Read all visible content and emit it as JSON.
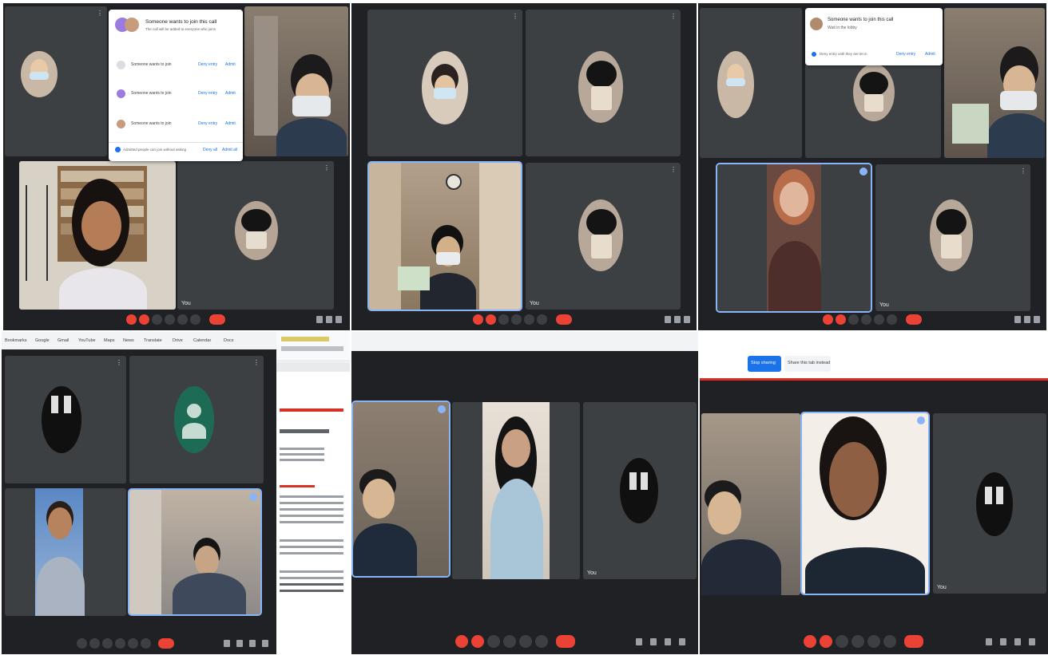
{
  "panels": {
    "top_left": {
      "popup": {
        "title": "Someone wants to join this call",
        "subtitle": "The call will be added to everyone who joins",
        "rows": [
          {
            "name": "Someone wants to join",
            "deny": "Deny entry",
            "admit": "Admit"
          },
          {
            "name": "Someone wants to join",
            "deny": "Deny entry",
            "admit": "Admit"
          },
          {
            "name": "Someone wants to join",
            "deny": "Deny entry",
            "admit": "Admit"
          }
        ],
        "footer": "Admitted people can join without asking",
        "footer_deny": "Deny all",
        "footer_admit": "Admit all"
      },
      "tiles": [
        {
          "name": "",
          "kind": "avatar"
        },
        {
          "name": "",
          "kind": "video"
        },
        {
          "name": "",
          "kind": "video"
        },
        {
          "name": "You",
          "kind": "avatar"
        }
      ]
    },
    "top_middle": {
      "tiles": [
        {
          "name": "",
          "kind": "avatar"
        },
        {
          "name": "",
          "kind": "avatar"
        },
        {
          "name": "",
          "kind": "video"
        },
        {
          "name": "You",
          "kind": "avatar"
        }
      ]
    },
    "top_right": {
      "popup": {
        "title": "Someone wants to join this call",
        "subtitle": "Wait in the lobby",
        "message": "Deny entry until they are let in",
        "deny": "Deny entry",
        "admit": "Admit"
      },
      "tiles": [
        {
          "name": "",
          "kind": "avatar"
        },
        {
          "name": "",
          "kind": "avatar"
        },
        {
          "name": "",
          "kind": "video"
        },
        {
          "name": "",
          "kind": "video"
        },
        {
          "name": "You",
          "kind": "avatar"
        }
      ]
    },
    "bottom_left": {
      "bookmarks": [
        "Bookmarks",
        "Google",
        "Gmail",
        "YouTube",
        "Maps",
        "News",
        "Translate",
        "Drive",
        "Calendar",
        "Docs"
      ],
      "tiles": [
        {
          "name": "",
          "kind": "avatar"
        },
        {
          "name": "",
          "kind": "avatar"
        },
        {
          "name": "",
          "kind": "video"
        },
        {
          "name": "",
          "kind": "video"
        }
      ],
      "call_info": ""
    },
    "bottom_middle": {
      "tiles": [
        {
          "name": "",
          "kind": "video"
        },
        {
          "name": "",
          "kind": "video"
        },
        {
          "name": "You",
          "kind": "avatar"
        }
      ],
      "call_info": ""
    },
    "bottom_right": {
      "share_bar": {
        "left_text": "",
        "primary": "Stop sharing",
        "secondary": "Share this tab instead"
      },
      "tiles": [
        {
          "name": "",
          "kind": "video"
        },
        {
          "name": "",
          "kind": "video"
        },
        {
          "name": "You",
          "kind": "avatar"
        }
      ],
      "call_info": ""
    }
  },
  "colors": {
    "meet_bg": "#202124",
    "tile_bg": "#3c4043",
    "end_call": "#ea4335",
    "accent": "#8ab4f8",
    "link": "#1a73e8"
  }
}
